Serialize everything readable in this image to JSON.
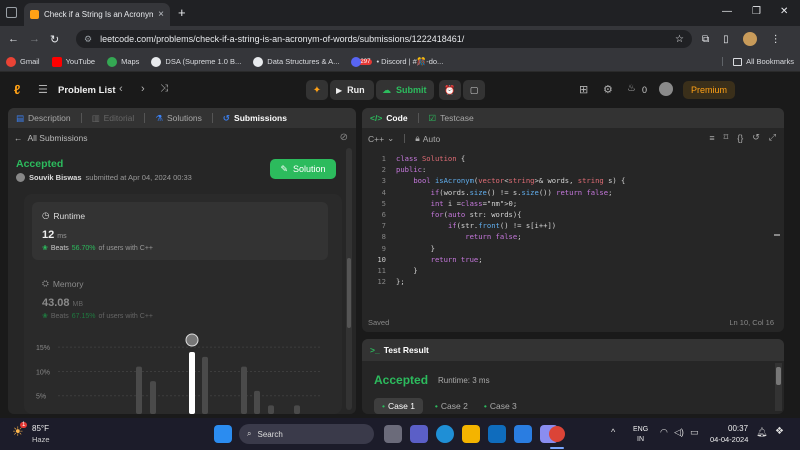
{
  "browser": {
    "tab_title": "Check if a String Is an Acronym",
    "tab_close": "×",
    "new_tab": "+",
    "url": "leetcode.com/problems/check-if-a-string-is-an-acronym-of-words/submissions/1222418461/",
    "bookmarks": [
      "Gmail",
      "YouTube",
      "Maps",
      "DSA (Supreme 1.0 B...",
      "Data Structures & A...",
      "• Discord | #🎊-do..."
    ],
    "discord_badge": "297",
    "all_bookmarks": "All Bookmarks"
  },
  "lc": {
    "problem_list": "Problem List",
    "run": "Run",
    "submit": "Submit",
    "streak": "0",
    "premium": "Premium"
  },
  "left": {
    "tabs": [
      "Description",
      "Editorial",
      "Solutions",
      "Submissions"
    ],
    "back": "All Submissions",
    "status": "Accepted",
    "user": "Souvik Biswas",
    "submitted": "submitted at Apr 04, 2024 00:33",
    "solution_btn": "Solution",
    "runtime": {
      "label": "Runtime",
      "value": "12",
      "unit": "ms",
      "beats": "Beats",
      "pct": "56.70%",
      "suffix": "of users with C++"
    },
    "memory": {
      "label": "Memory",
      "value": "43.08",
      "unit": "MB",
      "beats": "Beats",
      "pct": "67.15%",
      "suffix": "of users with C++"
    },
    "chart": {
      "ticks": [
        "15%",
        "10%",
        "5%"
      ]
    }
  },
  "chart_data": {
    "type": "bar",
    "yticks": [
      "15%",
      "10%",
      "5%"
    ],
    "ylim": [
      0,
      18
    ],
    "values": [
      11,
      8,
      14,
      13,
      11,
      6,
      3,
      3
    ],
    "highlight_index": 2
  },
  "code": {
    "tab": "Code",
    "testcase_tab": "Testcase",
    "lang": "C++",
    "mode": "Auto",
    "lines": [
      "class Solution {",
      "public:",
      "    bool isAcronym(vector<string>& words, string s) {",
      "        if(words.size() != s.size()) return false;",
      "        int i =0;",
      "        for(auto str: words){",
      "            if(str.front() != s[i++])",
      "                return false;",
      "        }",
      "        return true;",
      "    }",
      "};"
    ],
    "status": "Saved",
    "cursor": "Ln 10, Col 16"
  },
  "result": {
    "title": "Test Result",
    "status": "Accepted",
    "runtime": "Runtime: 3 ms",
    "cases": [
      "Case 1",
      "Case 2",
      "Case 3"
    ]
  },
  "taskbar": {
    "temp": "85°F",
    "weather": "Haze",
    "search": "Search",
    "lang1": "ENG",
    "lang2": "IN",
    "time": "00:37",
    "date": "04-04-2024",
    "notif": "1"
  },
  "colors": {
    "accent_green": "#2cbb5d",
    "accent_orange": "#ffa116",
    "bg": "#1a1a1a",
    "panel": "#262626"
  }
}
